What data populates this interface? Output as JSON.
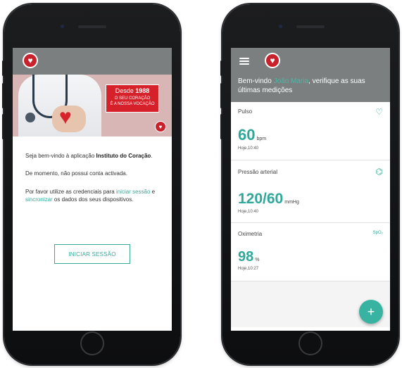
{
  "left_screen": {
    "hero": {
      "since_prefix": "Desde",
      "since_year": "1988",
      "slogan_line1": "O SEU CORAÇÃO",
      "slogan_line2": "É A NOSSA VOCAÇÃO"
    },
    "welcome_prefix": "Seja bem-vindo à aplicação ",
    "app_name": "Instituto do Coração",
    "welcome_suffix": ".",
    "no_account": "De momento, não possui conta activada.",
    "instr_prefix": "Por favor utilize as credenciais para ",
    "instr_link_login": "iniciar sessão",
    "instr_mid": " e ",
    "instr_link_sync": "sincronizar",
    "instr_suffix": " os dados dos seus dispositivos.",
    "login_button": "INICIAR SESSÃO"
  },
  "right_screen": {
    "welcome_prefix": "Bem-vindo ",
    "user_name": "João Maria",
    "welcome_suffix": ", verifique as suas últimas medições",
    "cards": [
      {
        "title": "Pulso",
        "value": "60",
        "unit": "bpm",
        "time": "Hoje,10:40",
        "icon": "heart-pulse-icon"
      },
      {
        "title": "Pressão arterial",
        "value": "120/60",
        "unit": "mmHg",
        "time": "Hoje,10:40",
        "icon": "blood-pressure-icon"
      },
      {
        "title": "Oximetria",
        "value": "98",
        "unit": "%",
        "time": "Hoje,10:27",
        "icon": "spo2-icon",
        "icon_text": "SpO₂"
      }
    ],
    "fab_label": "+"
  },
  "colors": {
    "appbar": "#7b7f80",
    "accent": "#3aa99a",
    "brand_red": "#d6202a"
  }
}
